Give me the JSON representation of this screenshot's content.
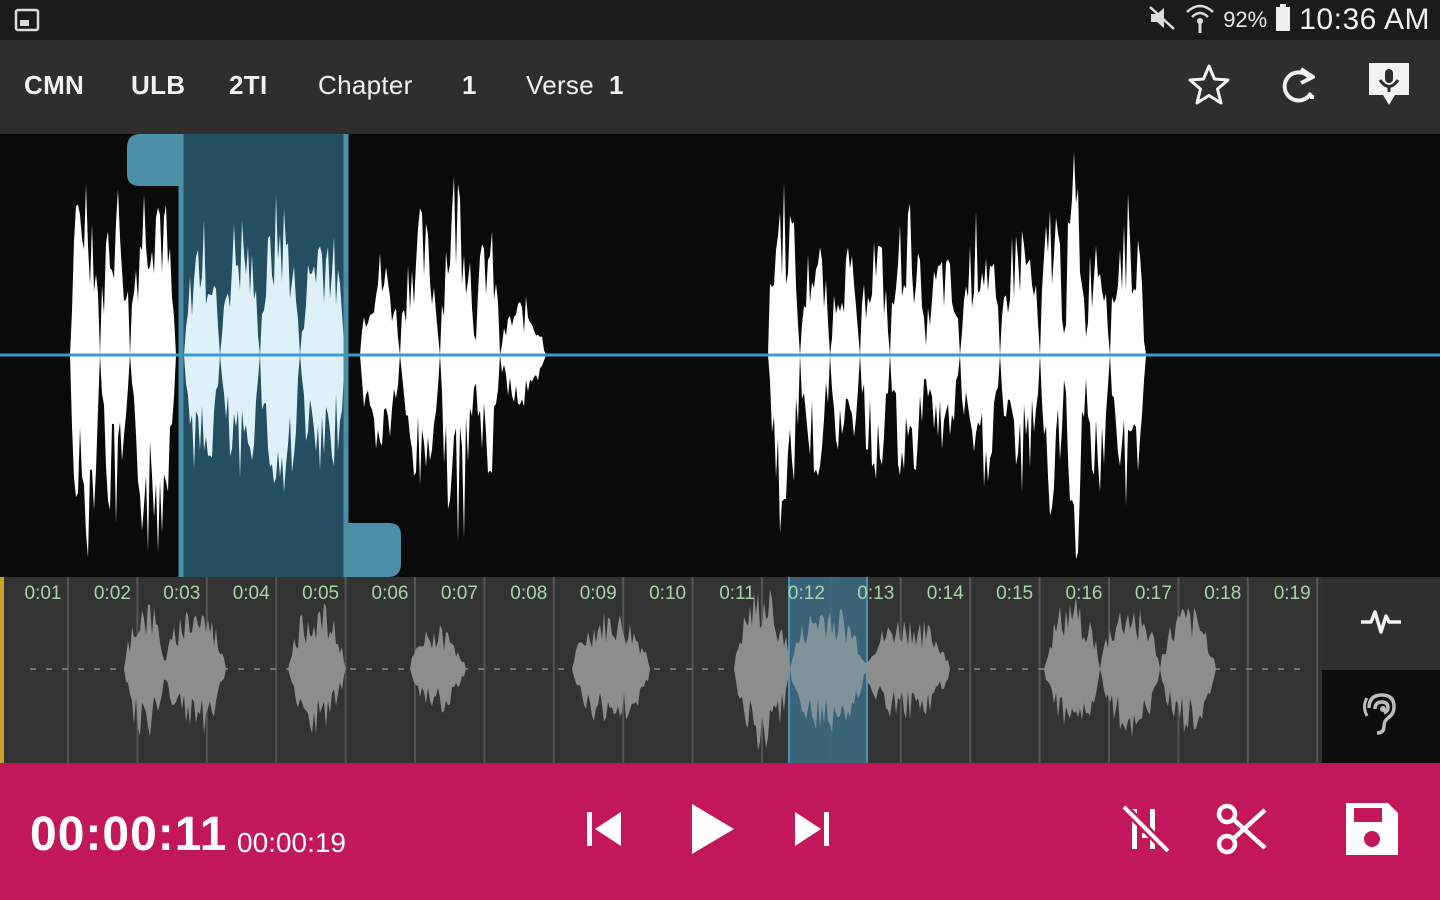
{
  "status_bar": {
    "battery": "92%",
    "time": "10:36 AM",
    "icons": [
      "screenshot-icon",
      "mute-icon",
      "wifi-icon",
      "battery-icon"
    ]
  },
  "toolbar": {
    "language": "CMN",
    "version": "ULB",
    "book": "2TI",
    "chapter_label": "Chapter",
    "chapter_number": "1",
    "verse_label": "Verse",
    "verse_number": "1",
    "icons": [
      "star-icon",
      "redo-icon",
      "insert-recording-icon"
    ]
  },
  "timeline": {
    "ticks": [
      "0:01",
      "0:02",
      "0:03",
      "0:04",
      "0:05",
      "0:06",
      "0:07",
      "0:08",
      "0:09",
      "0:10",
      "0:11",
      "0:12",
      "0:13",
      "0:14",
      "0:15",
      "0:16",
      "0:17",
      "0:18",
      "0:19"
    ]
  },
  "side_tools": {
    "icons": [
      "waveform-icon",
      "hearing-icon"
    ]
  },
  "playback": {
    "current_time": "00:00:11",
    "total_time": "00:00:19",
    "icons": [
      "skip-previous-icon",
      "play-icon",
      "skip-next-icon",
      "clear-markers-icon",
      "cut-icon",
      "save-icon"
    ]
  },
  "colors": {
    "accent": "#c2185b",
    "selection": "#1b3a47",
    "marker": "#4a8ea8",
    "tick_text": "#a5d6a7",
    "toolbar": "#2e2e2e",
    "status_bar": "#1b1b1b"
  }
}
